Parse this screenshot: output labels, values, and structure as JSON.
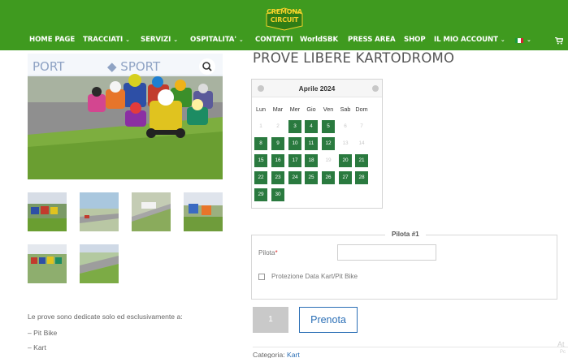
{
  "header": {
    "logo_text": "CREMONA CIRCUIT",
    "nav": [
      {
        "label": "HOME PAGE",
        "caret": false
      },
      {
        "label": "TRACCIATI",
        "caret": true
      },
      {
        "label": "SERVIZI",
        "caret": true
      },
      {
        "label": "OSPITALITA'",
        "caret": true
      },
      {
        "label": "CONTATTI",
        "caret": false
      },
      {
        "label": "WorldSBK",
        "caret": false
      },
      {
        "label": "PRESS AREA",
        "caret": false
      },
      {
        "label": "SHOP",
        "caret": false
      },
      {
        "label": "IL MIO ACCOUNT",
        "caret": true
      }
    ],
    "colors": {
      "bar": "#3f9a1f",
      "logo": "#f5d22a"
    },
    "icons": [
      "italian-flag-icon",
      "chevron-down-icon",
      "cart-icon"
    ]
  },
  "gallery": {
    "icons": [
      "search-icon"
    ]
  },
  "product": {
    "title": "PROVE LIBERE KARTODROMO",
    "description": {
      "intro": "Le prove sono dedicate solo ed esclusivamente a:",
      "items": [
        "– Pit Bike",
        "– Kart"
      ]
    },
    "category_label": "Categoria:",
    "category_link": "Kart"
  },
  "calendar": {
    "month": "Aprile 2024",
    "weekdays": [
      "Lun",
      "Mar",
      "Mer",
      "Gio",
      "Ven",
      "Sab",
      "Dom"
    ],
    "weeks": [
      [
        {
          "d": "1",
          "on": false
        },
        {
          "d": "2",
          "on": false
        },
        {
          "d": "3",
          "on": true
        },
        {
          "d": "4",
          "on": true
        },
        {
          "d": "5",
          "on": true
        },
        {
          "d": "6",
          "on": false
        },
        {
          "d": "7",
          "on": false
        }
      ],
      [
        {
          "d": "8",
          "on": true
        },
        {
          "d": "9",
          "on": true
        },
        {
          "d": "10",
          "on": true
        },
        {
          "d": "11",
          "on": true
        },
        {
          "d": "12",
          "on": true
        },
        {
          "d": "13",
          "on": false
        },
        {
          "d": "14",
          "on": false
        }
      ],
      [
        {
          "d": "15",
          "on": true
        },
        {
          "d": "16",
          "on": true
        },
        {
          "d": "17",
          "on": true
        },
        {
          "d": "18",
          "on": true
        },
        {
          "d": "19",
          "on": false
        },
        {
          "d": "20",
          "on": true
        },
        {
          "d": "21",
          "on": true
        }
      ],
      [
        {
          "d": "22",
          "on": true
        },
        {
          "d": "23",
          "on": true
        },
        {
          "d": "24",
          "on": true
        },
        {
          "d": "25",
          "on": true
        },
        {
          "d": "26",
          "on": true
        },
        {
          "d": "27",
          "on": true
        },
        {
          "d": "28",
          "on": true
        }
      ],
      [
        {
          "d": "29",
          "on": true
        },
        {
          "d": "30",
          "on": true
        }
      ]
    ],
    "available_color": "#2a7a3f"
  },
  "booking": {
    "pilot_legend": "Pilota #1",
    "pilot_label": "Pilota",
    "required_mark": "*",
    "pilot_value": "",
    "protection_label": "Protezione Data Kart/Pit Bike",
    "quantity": "1",
    "submit_label": "Prenota",
    "accent": "#2b6fb6"
  },
  "fragments": {
    "a": "At",
    "b": "Pc"
  }
}
